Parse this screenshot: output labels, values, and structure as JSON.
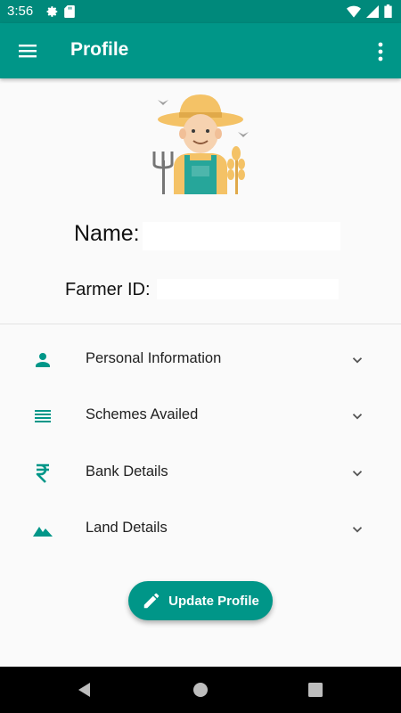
{
  "status_bar": {
    "time": "3:56",
    "left_icons": [
      "settings-icon",
      "sd-card-icon"
    ],
    "right_icons": [
      "wifi-icon",
      "signal-icon",
      "battery-icon"
    ]
  },
  "app_bar": {
    "title": "Profile",
    "left_icon": "menu-icon",
    "right_icon": "more-vert-icon",
    "color": "#009688",
    "status_color": "#00897b"
  },
  "profile": {
    "avatar_icon": "farmer-avatar-icon",
    "name_label": "Name:",
    "name_value": "",
    "farmer_id_label": "Farmer ID:",
    "farmer_id_value": ""
  },
  "sections": [
    {
      "label": "Personal Information",
      "icon": "person-icon"
    },
    {
      "label": "Schemes Availed",
      "icon": "list-icon"
    },
    {
      "label": "Bank Details",
      "icon": "rupee-icon"
    },
    {
      "label": "Land Details",
      "icon": "terrain-icon"
    }
  ],
  "update_button": {
    "label": "Update Profile",
    "icon": "edit-icon"
  },
  "nav_bar": [
    "back-icon",
    "home-icon",
    "recents-icon"
  ],
  "colors": {
    "accent": "#009688",
    "background": "#fafafa"
  }
}
